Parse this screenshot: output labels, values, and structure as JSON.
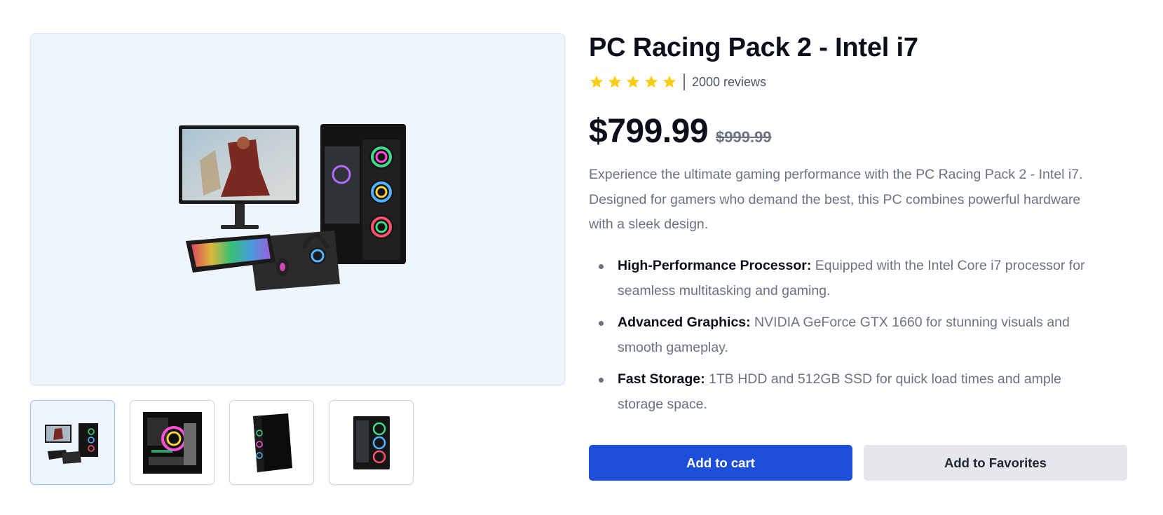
{
  "product": {
    "title": "PC Racing Pack 2 - Intel i7",
    "rating": {
      "stars": 5,
      "max_stars": 5,
      "reviews_text": "2000 reviews"
    },
    "price": "$799.99",
    "old_price": "$999.99",
    "description": "Experience the ultimate gaming performance with the PC Racing Pack 2 - Intel i7. Designed for gamers who demand the best, this PC combines powerful hardware with a sleek design.",
    "features": [
      {
        "label": "High-Performance Processor:",
        "text": " Equipped with the Intel Core i7 processor for seamless multitasking and gaming."
      },
      {
        "label": "Advanced Graphics:",
        "text": " NVIDIA GeForce GTX 1660 for stunning visuals and smooth gameplay."
      },
      {
        "label": "Fast Storage:",
        "text": " 1TB HDD and 512GB SSD for quick load times and ample storage space."
      }
    ]
  },
  "gallery": {
    "selected_index": 0,
    "thumbnails": [
      {
        "icon": "pc-bundle-thumbnail"
      },
      {
        "icon": "pc-interior-thumbnail"
      },
      {
        "icon": "black-case-thumbnail"
      },
      {
        "icon": "glass-case-thumbnail"
      }
    ]
  },
  "actions": {
    "add_to_cart_label": "Add to cart",
    "add_to_favorites_label": "Add to Favorites"
  },
  "colors": {
    "accent": "#1d4fd8",
    "star": "#facc15",
    "panel_bg": "#eef5ff",
    "secondary_button": "#e5e7eb"
  }
}
